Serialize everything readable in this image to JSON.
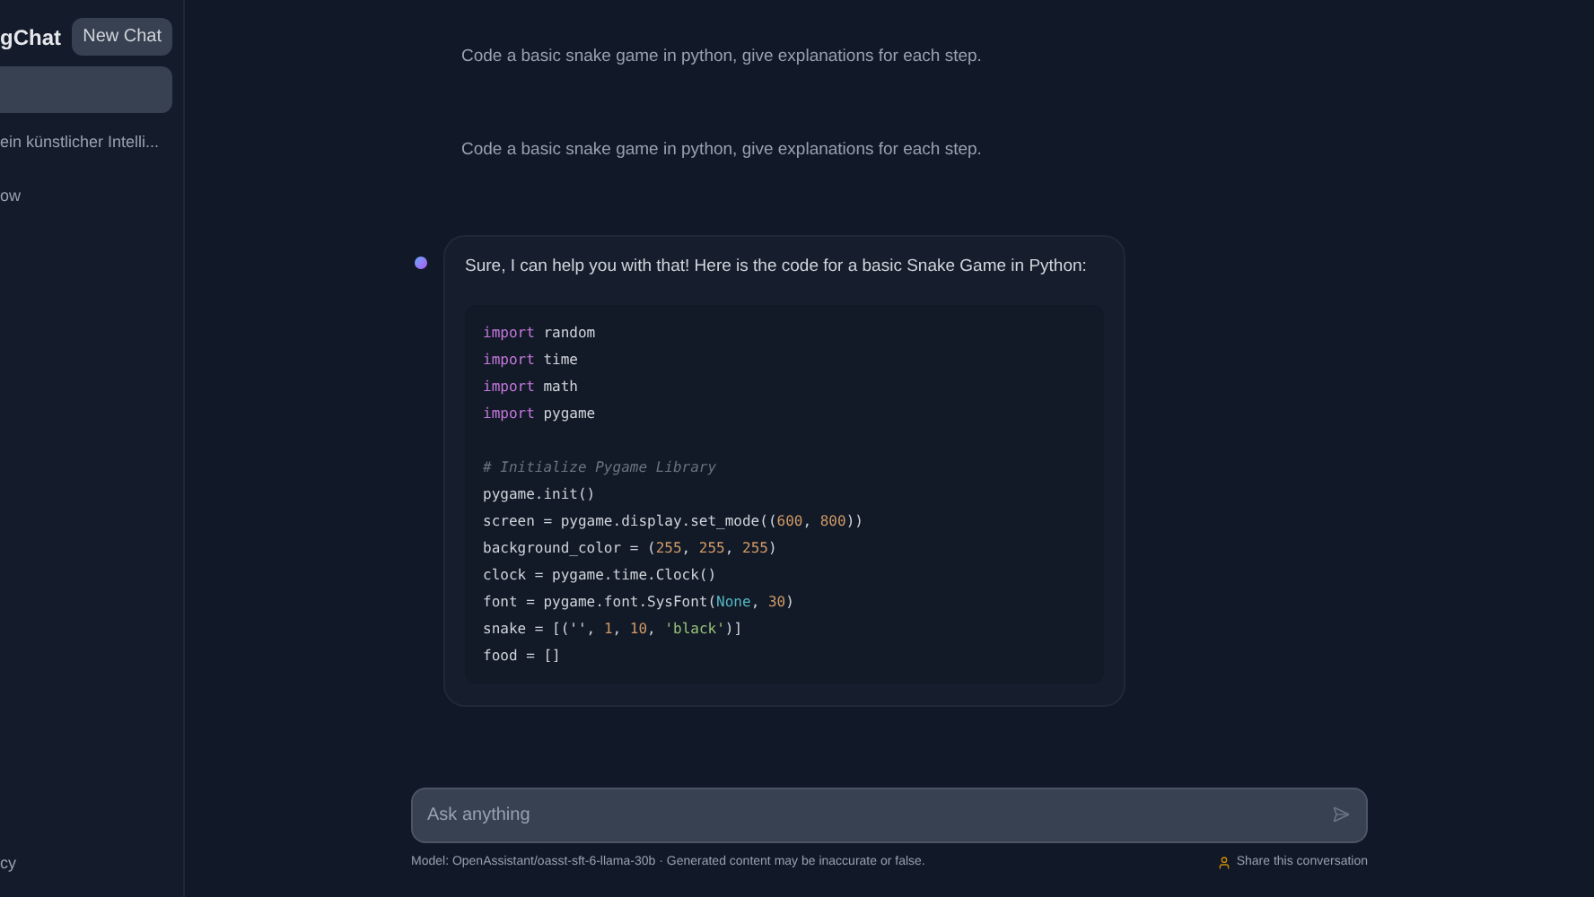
{
  "sidebar": {
    "title": "gChat",
    "new_chat_button": "New Chat",
    "conversations": [
      {
        "selected": true
      },
      {
        "title": "ein künstlicher Intelli...",
        "selected": false
      },
      {
        "title": "ow",
        "selected": false
      }
    ],
    "footer_link": "cy"
  },
  "messages": [
    {
      "kind": "user",
      "text": "Code a basic snake game in python, give explanations for each step."
    },
    {
      "kind": "user",
      "text": "Code a basic snake game in python, give explanations for each step."
    },
    {
      "kind": "assistant",
      "text": "Sure, I can help you with that! Here is the code for a basic Snake Game in Python:",
      "code": [
        {
          "kind": "code",
          "tokens": [
            {
              "kind": "keyword",
              "text": "import"
            },
            {
              "kind": "plain",
              "text": " random"
            }
          ]
        },
        {
          "kind": "code",
          "tokens": [
            {
              "kind": "keyword",
              "text": "import"
            },
            {
              "kind": "plain",
              "text": " time"
            }
          ]
        },
        {
          "kind": "code",
          "tokens": [
            {
              "kind": "keyword",
              "text": "import"
            },
            {
              "kind": "plain",
              "text": " math"
            }
          ]
        },
        {
          "kind": "code",
          "tokens": [
            {
              "kind": "keyword",
              "text": "import"
            },
            {
              "kind": "plain",
              "text": " pygame"
            }
          ]
        },
        {
          "kind": "blank"
        },
        {
          "kind": "code",
          "tokens": [
            {
              "kind": "comment",
              "text": "# Initialize Pygame Library"
            }
          ]
        },
        {
          "kind": "code",
          "tokens": [
            {
              "kind": "plain",
              "text": "pygame.init()"
            }
          ]
        },
        {
          "kind": "code",
          "tokens": [
            {
              "kind": "plain",
              "text": "screen = pygame.display.set_mode(("
            },
            {
              "kind": "number",
              "text": "600"
            },
            {
              "kind": "plain",
              "text": ", "
            },
            {
              "kind": "number",
              "text": "800"
            },
            {
              "kind": "plain",
              "text": "))"
            }
          ]
        },
        {
          "kind": "code",
          "tokens": [
            {
              "kind": "plain",
              "text": "background_color = ("
            },
            {
              "kind": "number",
              "text": "255"
            },
            {
              "kind": "plain",
              "text": ", "
            },
            {
              "kind": "number",
              "text": "255"
            },
            {
              "kind": "plain",
              "text": ", "
            },
            {
              "kind": "number",
              "text": "255"
            },
            {
              "kind": "plain",
              "text": ")"
            }
          ]
        },
        {
          "kind": "code",
          "tokens": [
            {
              "kind": "plain",
              "text": "clock = pygame.time.Clock()"
            }
          ]
        },
        {
          "kind": "code",
          "tokens": [
            {
              "kind": "plain",
              "text": "font = pygame.font.SysFont("
            },
            {
              "kind": "builtin",
              "text": "None"
            },
            {
              "kind": "plain",
              "text": ", "
            },
            {
              "kind": "number",
              "text": "30"
            },
            {
              "kind": "plain",
              "text": ")"
            }
          ]
        },
        {
          "kind": "code",
          "tokens": [
            {
              "kind": "plain",
              "text": "snake = [(''"
            },
            {
              "kind": "plain",
              "text": ", "
            },
            {
              "kind": "number",
              "text": "1"
            },
            {
              "kind": "plain",
              "text": ", "
            },
            {
              "kind": "number",
              "text": "10"
            },
            {
              "kind": "plain",
              "text": ", "
            },
            {
              "kind": "string",
              "text": "'black'"
            },
            {
              "kind": "plain",
              "text": ")]"
            }
          ]
        },
        {
          "kind": "code",
          "tokens": [
            {
              "kind": "plain",
              "text": "food = []"
            }
          ]
        }
      ]
    }
  ],
  "input": {
    "placeholder": "Ask anything"
  },
  "footer": {
    "model_note": "Model: OpenAssistant/oasst-sft-6-llama-30b · Generated content may be inaccurate or false.",
    "share_link": "Share this conversation"
  }
}
